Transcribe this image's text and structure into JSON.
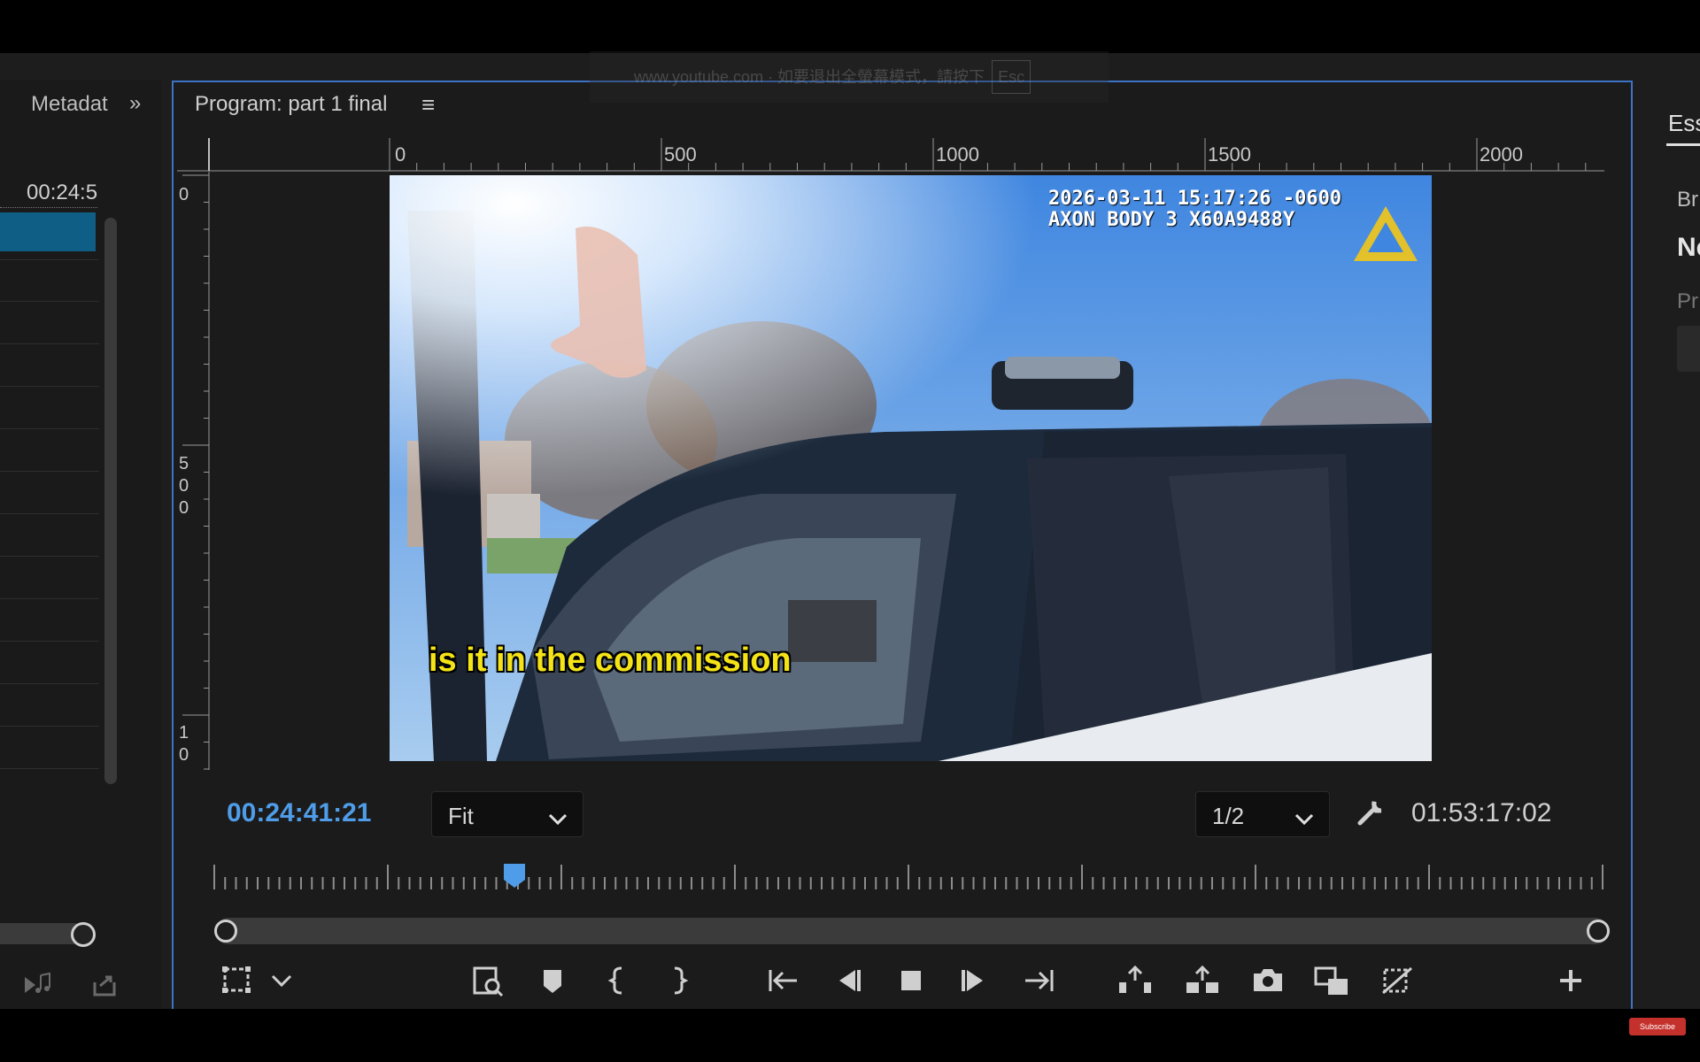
{
  "overlay": {
    "youtube_hint": "www.youtube.com · 如要退出全螢幕模式，請按下",
    "esc_key": "Esc"
  },
  "left_panel": {
    "tab_label": "Metadat",
    "expand_glyph": "»",
    "timecode": "00:24:5",
    "icons": [
      "audio-track-icon",
      "export-icon"
    ]
  },
  "program": {
    "title": "Program: part 1 final",
    "menu_glyph": "≡",
    "ruler_h_labels": [
      "0",
      "500",
      "1000",
      "1500",
      "2000"
    ],
    "ruler_v_labels": [
      "0",
      "5\n0\n0",
      "1\n0"
    ],
    "video": {
      "timestamp_line1": "2026-03-11 15:17:26 -0600",
      "timestamp_line2": "AXON BODY 3 X60A9488Y",
      "caption": "is it in the commission",
      "logo": "axon-logo"
    },
    "current_time": "00:24:41:21",
    "zoom_select": "Fit",
    "resolution_select": "1/2",
    "duration": "01:53:17:02",
    "colors": {
      "accent": "#4f9ce8",
      "panel_border": "#3d72c7",
      "caption": "#f4e316"
    }
  },
  "right_panel": {
    "tab_label": "Ess",
    "line_a": "Br",
    "line_b": "Ne",
    "line_c": "Pr"
  },
  "bottom": {
    "subscribe": "Subscribe"
  }
}
